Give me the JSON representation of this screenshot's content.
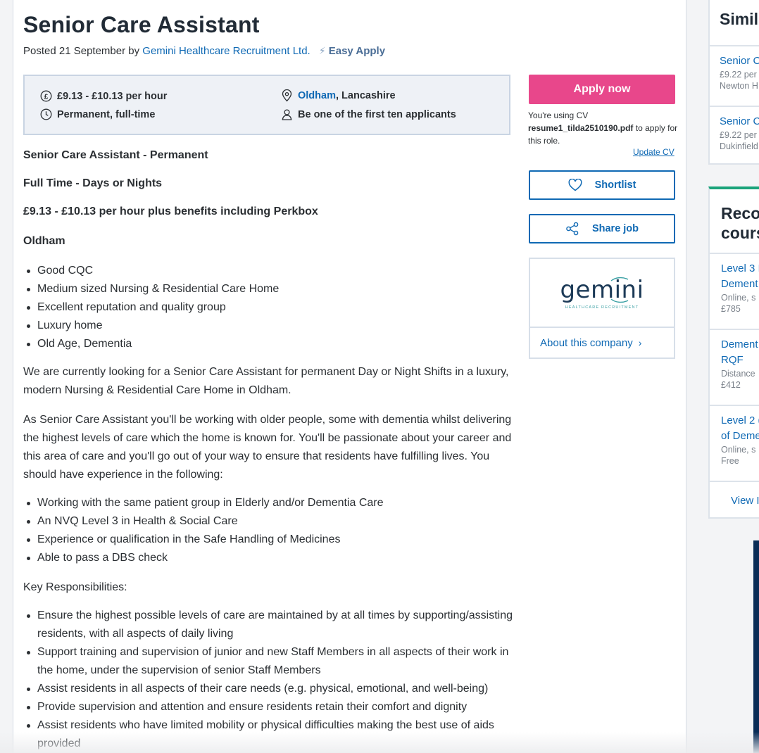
{
  "job": {
    "title": "Senior Care Assistant",
    "posted_prefix": "Posted 21 September by",
    "company": "Gemini Healthcare Recruitment Ltd.",
    "easy_apply": "Easy Apply"
  },
  "summary": {
    "salary": "£9.13 - £10.13 per hour",
    "job_type": "Permanent, full-time",
    "location_city": "Oldham",
    "location_region": ", Lancashire",
    "applicants": "Be one of the first ten applicants"
  },
  "description": {
    "headings": [
      "Senior Care Assistant - Permanent",
      "Full Time - Days or Nights",
      "£9.13 - £10.13 per hour plus benefits including Perkbox",
      "Oldham"
    ],
    "highlights": [
      "Good CQC",
      "Medium sized Nursing & Residential Care Home",
      "Excellent reputation and quality group",
      "Luxury home",
      "Old Age, Dementia"
    ],
    "para1": "We are currently looking for a Senior Care Assistant for permanent Day or Night Shifts in a luxury, modern Nursing & Residential Care Home in Oldham.",
    "para2": "As Senior Care Assistant you'll be working with older people, some with dementia whilst delivering the highest levels of care which the home is known for. You'll be passionate about your career and this area of care and you'll go out of your way to ensure that residents have fulfilling lives. You should have experience in the following:",
    "experience": [
      "Working with the same patient group in Elderly and/or Dementia Care",
      "An NVQ Level 3 in Health & Social Care",
      "Experience or qualification in the Safe Handling of Medicines",
      "Able to pass a DBS check"
    ],
    "responsibilities_heading": "Key Responsibilities:",
    "responsibilities": [
      "Ensure the highest possible levels of care are maintained by at all times by supporting/assisting residents, with all aspects of daily living",
      "Support training and supervision of junior and new Staff Members in all aspects of their work in the home, under the supervision of senior Staff Members",
      "Assist residents in all aspects of their care needs (e.g. physical, emotional, and well-being)",
      "Provide supervision and attention and ensure residents retain their comfort and dignity",
      "Assist residents who have limited mobility or physical difficulties making the best use of aids provided"
    ]
  },
  "actions": {
    "apply_label": "Apply now",
    "cv_prefix": "You're using CV",
    "cv_file": "resume1_tilda2510190.pdf",
    "cv_suffix": "to apply for this role.",
    "update_cv": "Update CV",
    "shortlist": "Shortlist",
    "share": "Share job",
    "logo_word": "gemini",
    "logo_sub": "HEALTHCARE RECRUITMENT",
    "about_company": "About this company"
  },
  "similar": {
    "heading": "Simil",
    "items": [
      {
        "title": "Senior C",
        "pay": "£9.22 per",
        "place": "Newton H"
      },
      {
        "title": "Senior C",
        "pay": "£9.22 per",
        "place": "Dukinfield"
      }
    ]
  },
  "courses": {
    "heading_line1": "Reco",
    "heading_line2": "cours",
    "items": [
      {
        "title1": "Level 3 I",
        "title2": "Dement",
        "meta": "Online, s",
        "price": "£785"
      },
      {
        "title1": "Dement",
        "title2": "RQF",
        "meta": "Distance",
        "price": "£412"
      },
      {
        "title1": "Level 2 (",
        "title2": "of Deme",
        "meta": "Online, s",
        "price": "Free"
      }
    ],
    "view_all": "View I"
  },
  "colors": {
    "link": "#0f69b4",
    "apply_button": "#e8478b",
    "accent_green": "#1aa37a",
    "dark_navy": "#0a2d57"
  }
}
